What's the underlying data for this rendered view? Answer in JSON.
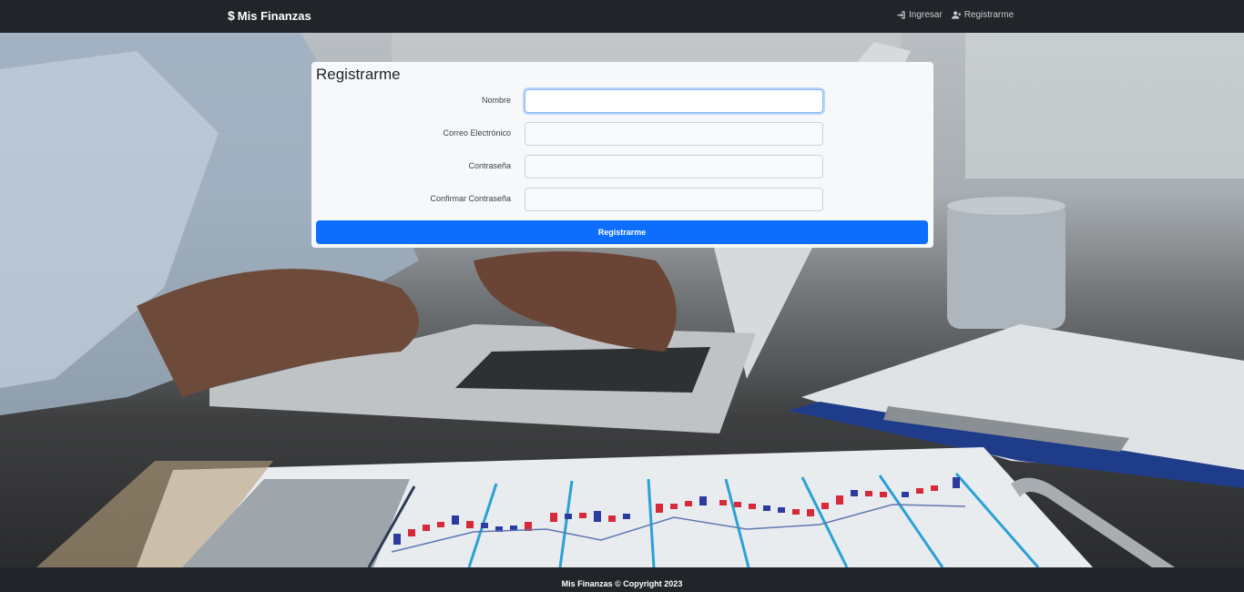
{
  "navbar": {
    "brand_icon": "dollar-icon",
    "brand": "Mis Finanzas",
    "links": [
      {
        "icon": "login-icon",
        "label": "Ingresar"
      },
      {
        "icon": "user-plus-icon",
        "label": "Registrarme"
      }
    ]
  },
  "form": {
    "title": "Registrarme",
    "fields": [
      {
        "label": "Nombre",
        "value": "",
        "placeholder": ""
      },
      {
        "label": "Correo Electrónico",
        "value": "",
        "placeholder": ""
      },
      {
        "label": "Contraseña",
        "value": "",
        "placeholder": ""
      },
      {
        "label": "Confirmar Contraseña",
        "value": "",
        "placeholder": ""
      }
    ],
    "submit_label": "Registrarme"
  },
  "footer": {
    "text": "Mis Finanzas © Copyright 2023"
  },
  "colors": {
    "navbar": "#212529",
    "primary": "#0d6efd",
    "card": "#f6f8fa",
    "focus_border": "#86b7fe"
  }
}
